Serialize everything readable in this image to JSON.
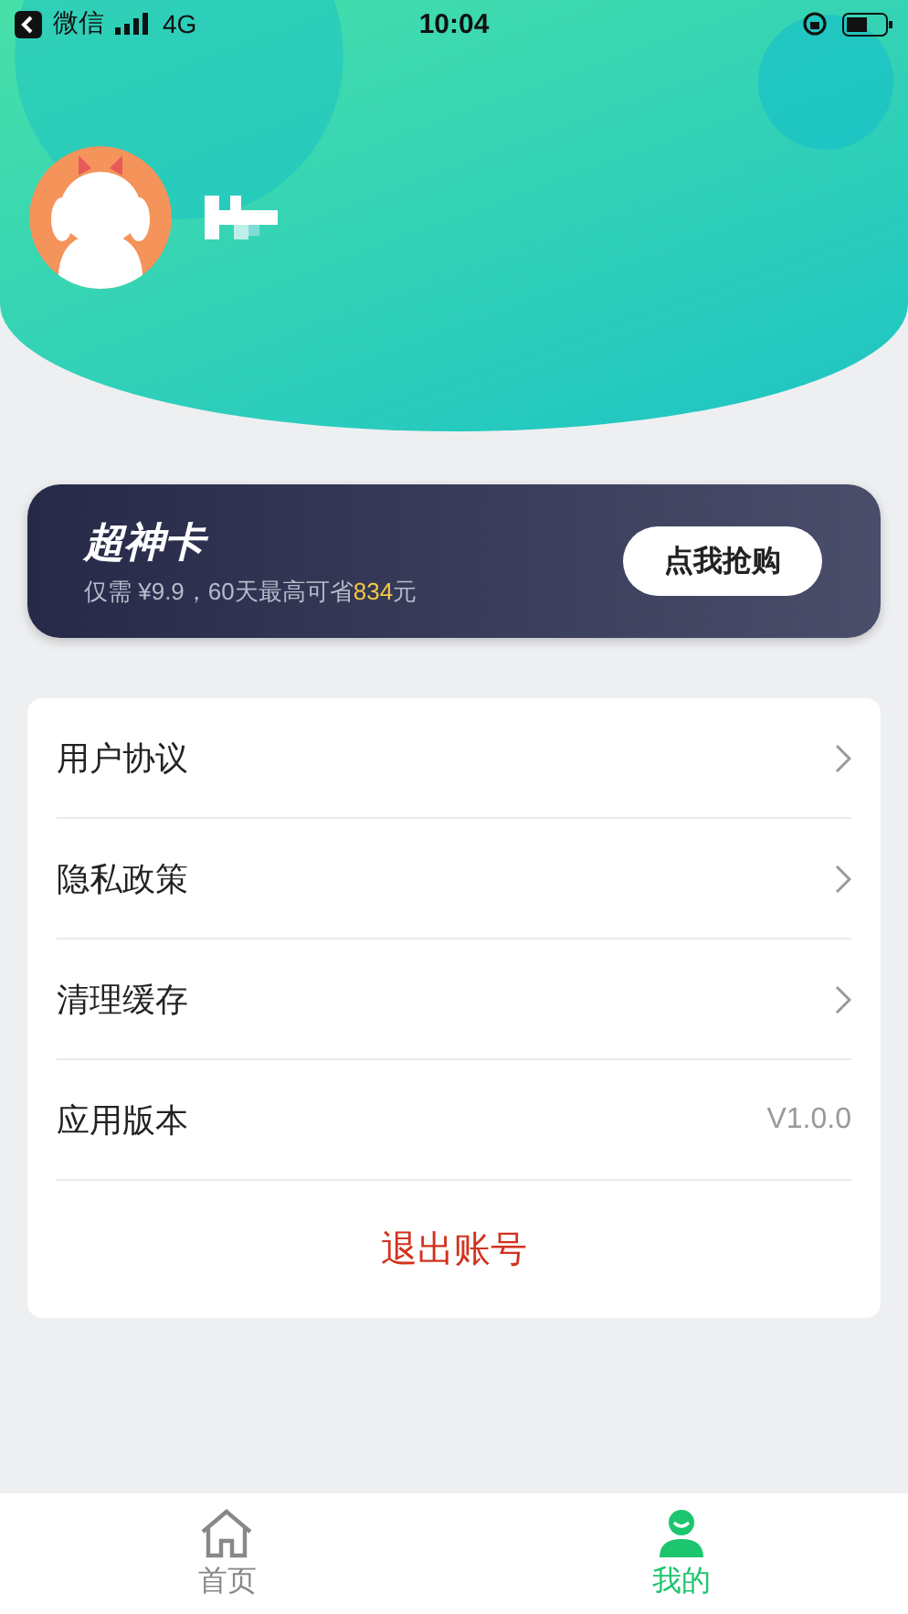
{
  "status_bar": {
    "back_app": "微信",
    "network": "4G",
    "time": "10:04"
  },
  "promo": {
    "title": "超神卡",
    "subtitle": "仅需 ¥9.9，60天最高可省",
    "highlight": "834",
    "unit": "元",
    "button": "点我抢购"
  },
  "menu": [
    {
      "kind": "link",
      "label": "用户协议"
    },
    {
      "kind": "link",
      "label": "隐私政策"
    },
    {
      "kind": "link",
      "label": "清理缓存"
    },
    {
      "kind": "value",
      "label": "应用版本",
      "value": "V1.0.0"
    },
    {
      "kind": "action",
      "label": "退出账号"
    }
  ],
  "tabs": [
    {
      "label": "首页",
      "kind": "home",
      "selected": false
    },
    {
      "label": "我的",
      "kind": "person",
      "selected": true
    }
  ]
}
